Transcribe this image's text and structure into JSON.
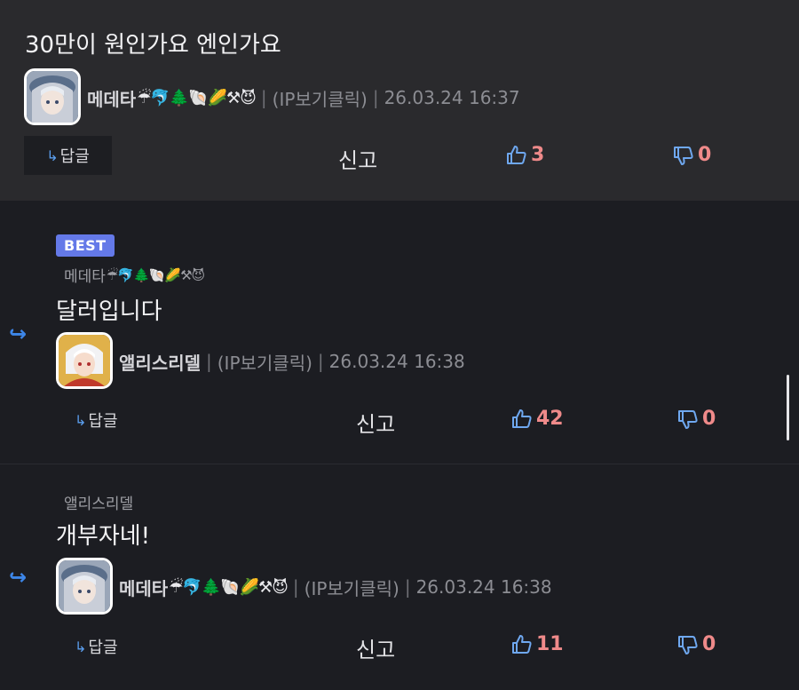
{
  "comments": [
    {
      "text": "30만이 원인가요 엔인가요",
      "author": "메데타",
      "emojis": "☔🐬🌲🐚🌽⚒😈",
      "ip": "(IP보기클릭)",
      "date": "26.03.24 16:37",
      "reply_label": "답글",
      "report_label": "신고",
      "upvotes": "3",
      "downvotes": "0"
    },
    {
      "badge": "BEST",
      "parent_author": "메데타",
      "parent_emojis": "☔🐬🌲🐚🌽⚒😈",
      "text": "달러입니다",
      "author": "앨리스리델",
      "ip": "(IP보기클릭)",
      "date": "26.03.24 16:38",
      "reply_label": "답글",
      "report_label": "신고",
      "upvotes": "42",
      "downvotes": "0"
    },
    {
      "parent_author": "앨리스리델",
      "text": "개부자네!",
      "author": "메데타",
      "emojis": "☔🐬🌲🐚🌽⚒😈",
      "ip": "(IP보기클릭)",
      "date": "26.03.24 16:38",
      "reply_label": "답글",
      "report_label": "신고",
      "upvotes": "11",
      "downvotes": "0"
    }
  ],
  "icons": {
    "reply_arrow": "↳",
    "reply_indicator": "↪",
    "separator": "|"
  },
  "colors": {
    "accent_blue": "#5b9fef",
    "best_badge": "#6479e8",
    "vote_count": "#ef8a8a"
  }
}
